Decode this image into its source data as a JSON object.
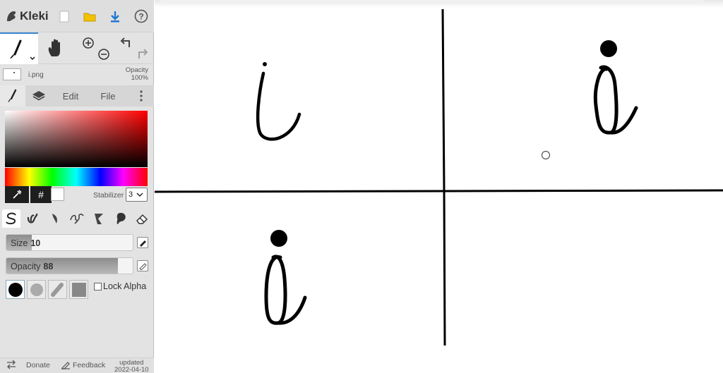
{
  "app": {
    "name": "Kleki",
    "icons": {
      "logo": "kleki-logo-icon",
      "new": "new-image-icon",
      "save": "save-folder-icon",
      "download": "download-icon",
      "help": "help-icon"
    }
  },
  "toolbar": {
    "tools": [
      "brush",
      "hand",
      "zoom-in",
      "zoom-out",
      "undo",
      "redo"
    ]
  },
  "layer": {
    "filename": "i.png",
    "opacity_label": "Opacity",
    "opacity_value": "100%"
  },
  "tabs": {
    "edit": "Edit",
    "file": "File"
  },
  "color": {
    "hex_button": "#",
    "current": "#ffffff",
    "stabilizer_label": "Stabilizer",
    "stabilizer_value": "3"
  },
  "brush": {
    "size_label": "Size",
    "size_value": "10",
    "size_fraction": 0.2,
    "opacity_label": "Opacity",
    "opacity_value": "88",
    "opacity_fraction": 0.88,
    "lock_alpha": "Lock Alpha"
  },
  "footer": {
    "donate": "Donate",
    "feedback": "Feedback",
    "updated_label": "updated",
    "updated_date": "2022-04-10"
  }
}
